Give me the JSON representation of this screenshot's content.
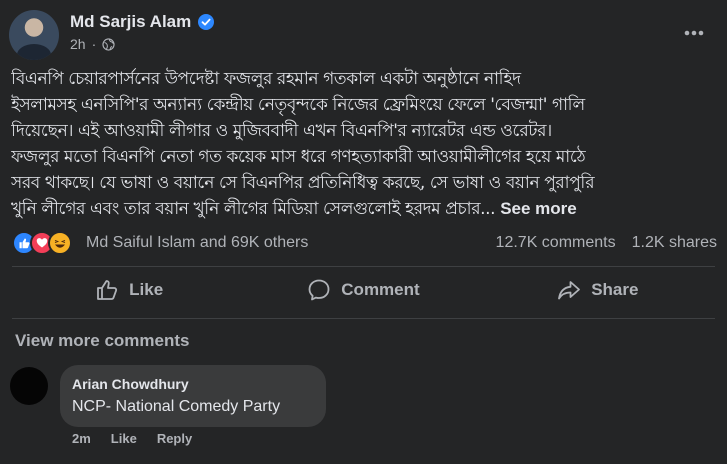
{
  "post": {
    "author": "Md Sarjis Alam",
    "time": "2h",
    "dot": "·",
    "text_lines": [
      "বিএনপি চেয়ারপার্সনের উপদেষ্টা ফজলুর রহমান গতকাল একটা অনুষ্ঠানে নাহিদ",
      "ইসলামসহ এনসিপি'র অন্যান্য কেন্দ্রীয় নেতৃবৃন্দকে নিজের ফ্রেমিংয়ে ফেলে 'বেজন্মা' গালি",
      "দিয়েছেন। এই আওয়ামী লীগার ও মুজিববাদী এখন বিএনপি'র ন্যারেটর এন্ড ওরেটর।",
      "ফজলুর মতো বিএনপি নেতা গত কয়েক মাস ধরে গণহত্যাকারী আওয়ামীলীগের হয়ে মাঠে",
      "সরব থাকছে। যে ভাষা ও বয়ানে সে বিএনপির প্রতিনিধিত্ব করছে, সে ভাষা ও বয়ান পুরাপুরি",
      "খুনি লীগের এবং তার বয়ান খুনি লীগের মিডিয়া সেলগুলোই হরদম প্রচার..."
    ],
    "see_more": "See more"
  },
  "stats": {
    "reaction_names": "Md Saiful Islam and 69K others",
    "comments": "12.7K comments",
    "shares": "1.2K shares"
  },
  "actions": {
    "like": "Like",
    "comment": "Comment",
    "share": "Share"
  },
  "comments": {
    "view_more": "View more comments",
    "items": [
      {
        "author": "Arian Chowdhury",
        "text": "NCP- National Comedy Party",
        "time": "2m",
        "like": "Like",
        "reply": "Reply"
      }
    ]
  },
  "icons": {
    "verified": "verified-badge-icon",
    "globe": "globe-icon",
    "more": "more-options-icon",
    "like": "thumbs-up-icon",
    "comment": "comment-bubble-icon",
    "share": "share-arrow-icon"
  },
  "colors": {
    "background": "#242526",
    "text": "#e4e6eb",
    "muted": "#b0b3b8",
    "verified": "#2d88ff",
    "like_reaction": "#2d86ff",
    "love_reaction": "#f33e58",
    "haha_reaction": "#f7b125"
  }
}
